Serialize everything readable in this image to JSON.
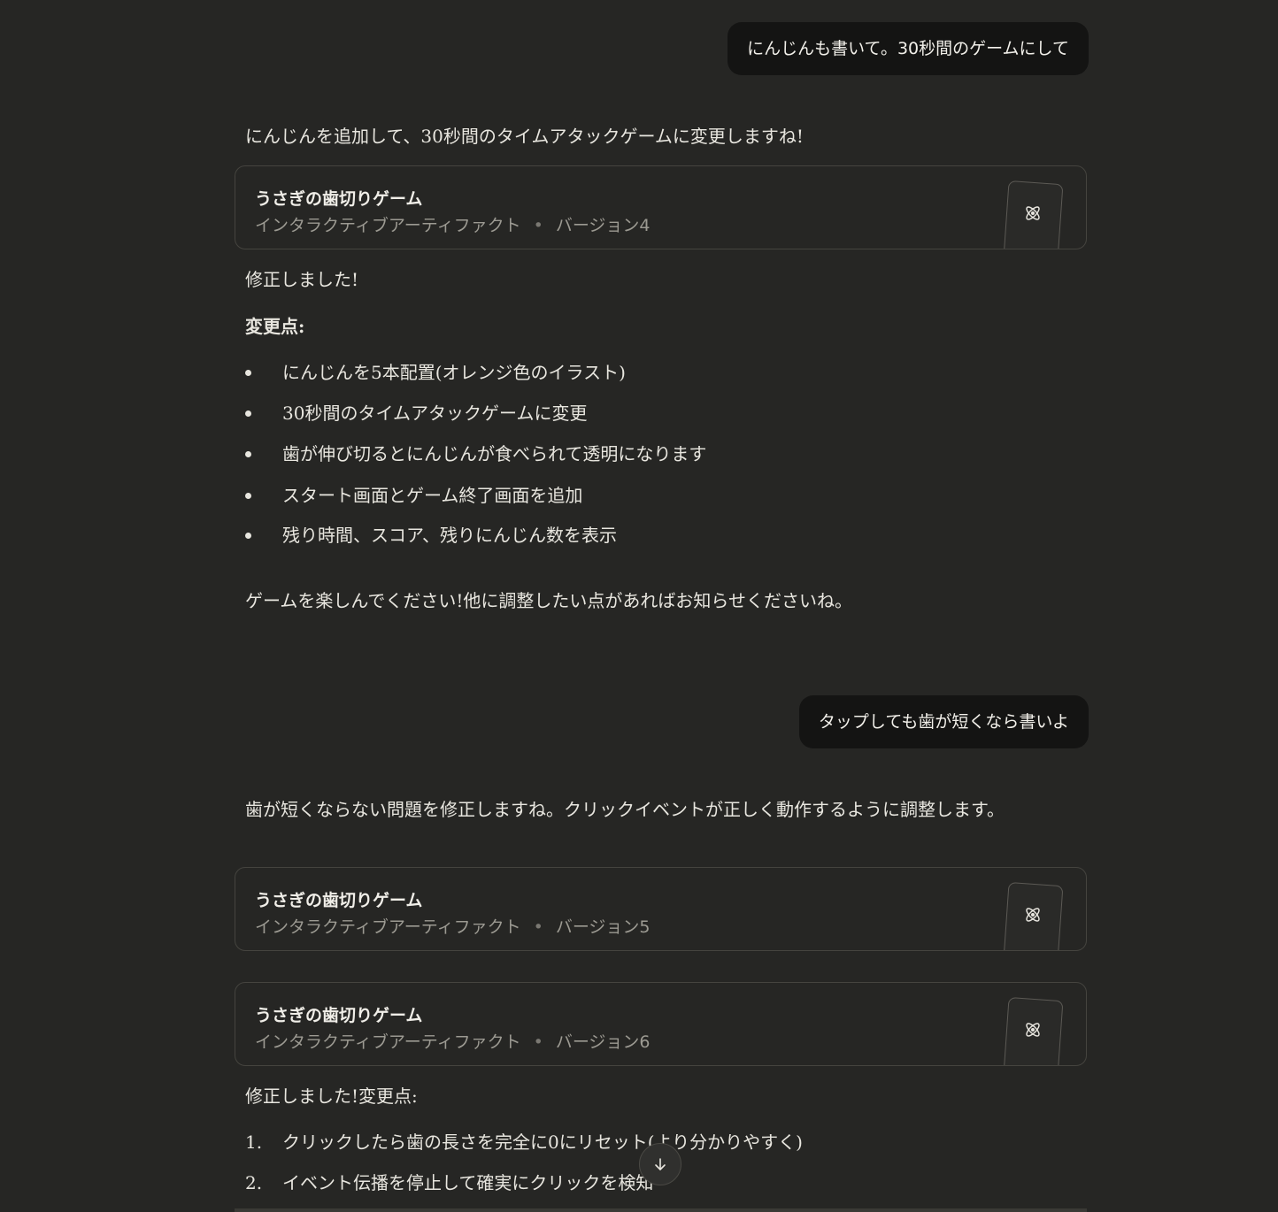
{
  "messages": {
    "user1": "にんじんも書いて。30秒間のゲームにして",
    "reply1_intro": "にんじんを追加して、30秒間のタイムアタックゲームに変更しますね!",
    "artifact_v4": {
      "title": "うさぎの歯切りゲーム",
      "type": "インタラクティブアーティファクト",
      "version": "バージョン4"
    },
    "reply1_done": "修正しました!",
    "reply1_changes_heading": "変更点:",
    "reply1_changes": [
      "にんじんを5本配置(オレンジ色のイラスト)",
      "30秒間のタイムアタックゲームに変更",
      "歯が伸び切るとにんじんが食べられて透明になります",
      "スタート画面とゲーム終了画面を追加",
      "残り時間、スコア、残りにんじん数を表示"
    ],
    "reply1_outro": "ゲームを楽しんでください!他に調整したい点があればお知らせくださいね。",
    "user2": "タップしても歯が短くなら書いよ",
    "reply2_intro": "歯が短くならない問題を修正しますね。クリックイベントが正しく動作するように調整します。",
    "artifact_v5": {
      "title": "うさぎの歯切りゲーム",
      "type": "インタラクティブアーティファクト",
      "version": "バージョン5"
    },
    "artifact_v6": {
      "title": "うさぎの歯切りゲーム",
      "type": "インタラクティブアーティファクト",
      "version": "バージョン6"
    },
    "reply2_done": "修正しました!変更点:",
    "reply2_changes": [
      {
        "num": "1.",
        "text": "クリックしたら歯の長さを完全に0にリセット(より分かりやすく)"
      },
      {
        "num": "2.",
        "text": "イベント伝播を停止して確実にクリックを検知"
      }
    ]
  },
  "icons": {
    "artifact": "atom-icon",
    "scroll": "arrow-down-icon"
  },
  "colors": {
    "background": "#262624",
    "user_bubble": "#141413",
    "text": "#e8e6df",
    "muted": "#9c9a92"
  }
}
